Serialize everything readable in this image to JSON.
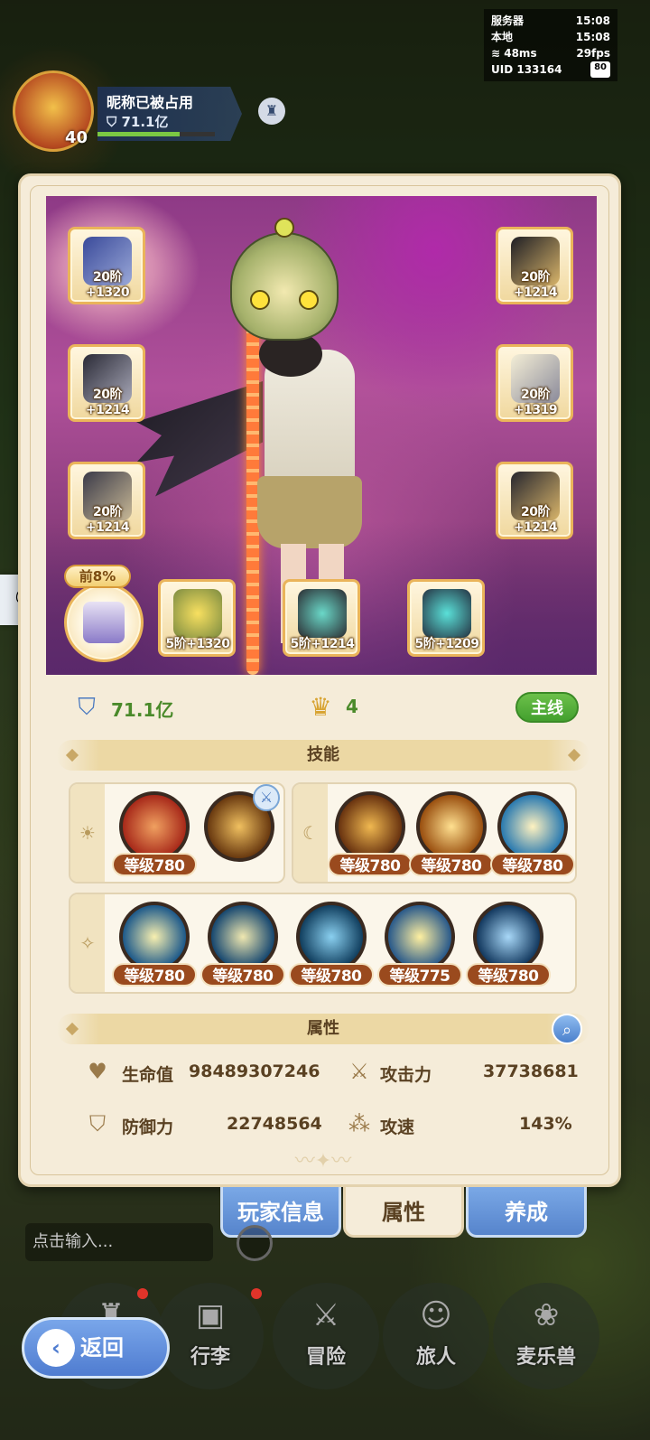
{
  "status": {
    "server_label": "服务器",
    "server_time": "15:08",
    "local_label": "本地",
    "local_time": "15:08",
    "ping": "48ms",
    "fps": "29fps",
    "uid_label": "UID",
    "uid": "133164",
    "battery": "80"
  },
  "profile": {
    "level": "40",
    "name": "昵称已被占用",
    "power": "71.1亿"
  },
  "equipment": {
    "left": [
      {
        "label": "20阶+1320",
        "icon": "sword-icon"
      },
      {
        "label": "20阶+1214",
        "icon": "armor-icon"
      },
      {
        "label": "20阶+1214",
        "icon": "pants-icon"
      }
    ],
    "right": [
      {
        "label": "20阶+1214",
        "icon": "helmet-icon"
      },
      {
        "label": "20阶+1319",
        "icon": "gloves-icon"
      },
      {
        "label": "20阶+1214",
        "icon": "boots-icon"
      }
    ],
    "accessories": [
      {
        "label": "5阶+1320",
        "icon": "ring-icon"
      },
      {
        "label": "5阶+1214",
        "icon": "necklace-icon"
      },
      {
        "label": "5阶+1209",
        "icon": "charm-icon"
      }
    ],
    "rank_badge": "前8%"
  },
  "summary": {
    "power": "71.1亿",
    "crown_count": "4",
    "mainline_label": "主线"
  },
  "skills": {
    "header": "技能",
    "group_day": [
      "等级780"
    ],
    "group_night": [
      "等级780",
      "等级780",
      "等级780"
    ],
    "group_star": [
      "等级780",
      "等级780",
      "等级780",
      "等级775",
      "等级780"
    ]
  },
  "attributes": {
    "header": "属性",
    "hp_label": "生命值",
    "hp_value": "98489307246",
    "atk_label": "攻击力",
    "atk_value": "37738681",
    "def_label": "防御力",
    "def_value": "22748564",
    "spd_label": "攻速",
    "spd_value": "143%"
  },
  "tabs": {
    "player_info": "玩家信息",
    "attributes": "属性",
    "training": "养成"
  },
  "chat": {
    "placeholder": "点击输入..."
  },
  "nav": {
    "back": "返回",
    "items": [
      "行李",
      "冒险",
      "旅人",
      "麦乐兽"
    ]
  },
  "colors": {
    "accent_green": "#4a8a2a",
    "level_pill": "#9a4a1e",
    "tab_blue": "#5684cc",
    "panel_bg": "#f5ecd9"
  }
}
